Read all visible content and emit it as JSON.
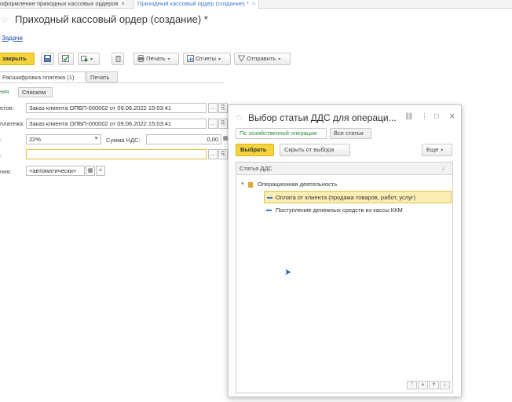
{
  "tabs": [
    {
      "label": "оформление приходных кассовых ордеров",
      "close": "×"
    },
    {
      "label": "Приходный кассовый ордер (создание) *",
      "close": "×"
    }
  ],
  "page": {
    "title": "Приходный кассовый ордер (создание) *",
    "tasks_link": "Задачи"
  },
  "toolbar": {
    "save_close": "закрыть",
    "print": "Печать",
    "reports": "Отчеты",
    "send": "Отправить"
  },
  "subtabs": {
    "decoding": "Расшифровка платежа (1)",
    "print": "Печать"
  },
  "view_toggle": {
    "partial": "ния",
    "list": "Списком"
  },
  "form": {
    "row1_label": "етов:",
    "row1_value": "Заказ клиента ОПБП-000002 от 09.06.2022 15:03:41",
    "row2_label": "платежа:",
    "row2_value": "Заказ клиента ОПБП-000002 от 09.06.2022 15:03:41",
    "vat_rate_label": ":",
    "vat_rate_value": "22%",
    "vat_sum_label": "Сумма НДС:",
    "vat_sum_value": "0,00",
    "row4_label": ":",
    "row4_value": "",
    "row5_label": "ния:",
    "row5_value": "<автоматически>",
    "btn_more": "...",
    "btn_open": "⎘",
    "btn_clear": "×"
  },
  "dialog": {
    "title": "Выбор статьи ДДС для операци...",
    "filter_active": "По хозяйственной операции",
    "filter_all": "Все статьи",
    "select_btn": "Выбрать",
    "hide_btn": "Скрыть от выбора",
    "more_btn": "Еще",
    "column_header": "Статья ДДС",
    "rows": [
      {
        "label": "Операционная деятельность"
      },
      {
        "label": "Оплата от клиента (продажа товаров, работ, услуг)"
      },
      {
        "label": "Поступление денежных средств из кассы ККМ"
      }
    ]
  },
  "colors": {
    "accent_yellow": "#f5d33d",
    "selection": "#fbeeb5",
    "link": "#1a4fa3",
    "green": "#2d8c3c"
  }
}
